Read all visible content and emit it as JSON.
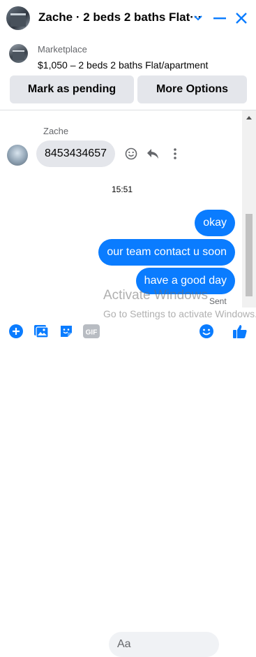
{
  "header": {
    "title": "Zache · 2 beds 2 baths Flat···",
    "accent_color": "#0a7cff"
  },
  "listing": {
    "label": "Marketplace",
    "name": "$1,050 – 2 beds 2 baths Flat/apartment"
  },
  "actions": {
    "mark_pending": "Mark as pending",
    "more_options": "More Options"
  },
  "thread": {
    "sender_name": "Zache",
    "incoming": [
      {
        "text": "8453434657"
      }
    ],
    "timestamp": "15:51",
    "outgoing": [
      {
        "text": "okay"
      },
      {
        "text": "our team contact u soon"
      },
      {
        "text": "have a good day"
      }
    ],
    "status": "Sent"
  },
  "watermark": {
    "line1": "Activate Windows",
    "line2": "Go to Settings to activate Windows."
  },
  "composer": {
    "placeholder": "Aa",
    "icons": [
      "plus-circle-icon",
      "image-icon",
      "sticker-icon",
      "gif-icon",
      "emoji-icon",
      "thumbs-up-icon"
    ]
  }
}
